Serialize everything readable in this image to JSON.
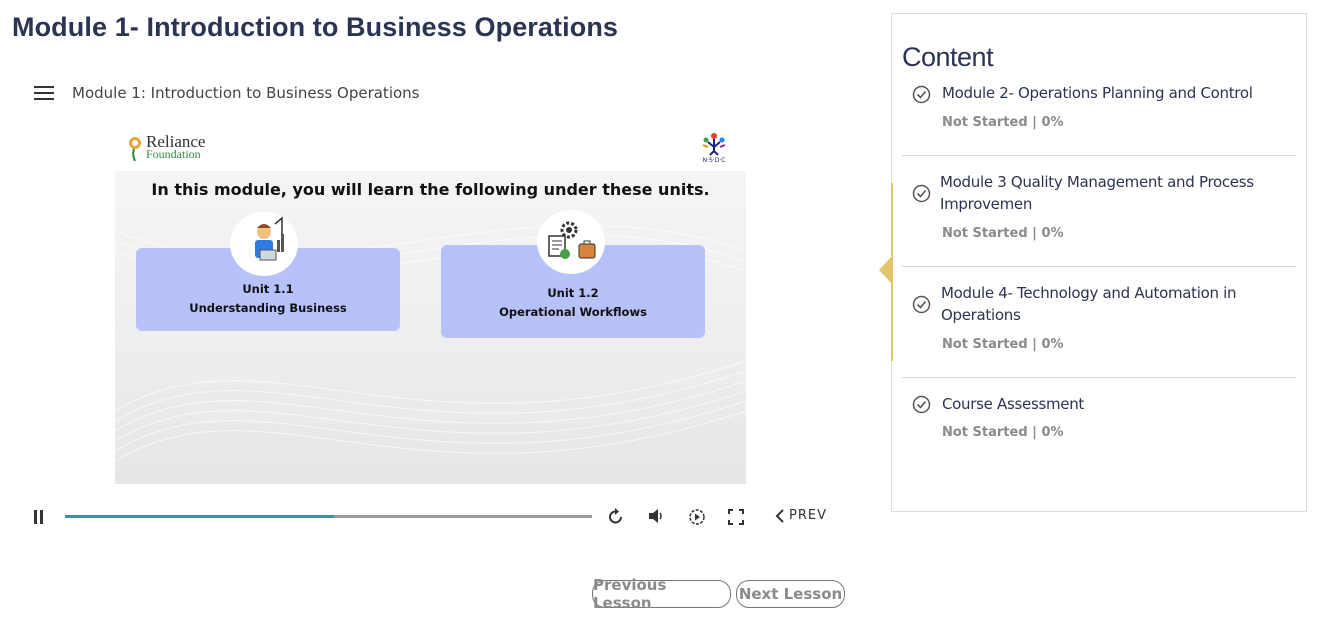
{
  "page": {
    "title": "Module 1- Introduction to Business Operations"
  },
  "player": {
    "menu_icon": "hamburger-menu-icon",
    "title": "Module 1: Introduction to Business Operations",
    "slide": {
      "logo_left": {
        "line1": "Reliance",
        "line2": "Foundation"
      },
      "logo_right": "N·S·D·C",
      "heading": "In this module, you will learn the following under these units.",
      "units": [
        {
          "number": "Unit 1.1",
          "name": "Understanding Business"
        },
        {
          "number": "Unit 1.2",
          "name": "Operational Workflows"
        }
      ]
    },
    "controls": {
      "progress_fraction": 0.51,
      "prev_label": "PREV",
      "icons": [
        "pause-icon",
        "replay-icon",
        "volume-icon",
        "playback-speed-icon",
        "fullscreen-icon",
        "chevron-left-icon"
      ]
    },
    "accent": "#3f8fa9"
  },
  "lesson_nav": {
    "previous": "Previous Lesson",
    "next": "Next Lesson"
  },
  "sidebar": {
    "title": "Content",
    "accent": "#e2c66e",
    "items": [
      {
        "title": "Module 2- Operations Planning and Control",
        "status": "Not Started | 0%"
      },
      {
        "title": "Module 3 Quality Management and Process Improvemen",
        "status": "Not Started | 0%"
      },
      {
        "title": "Module 4- Technology and Automation in Operations",
        "status": "Not Started | 0%"
      },
      {
        "title": "Course Assessment",
        "status": "Not Started | 0%"
      }
    ]
  }
}
